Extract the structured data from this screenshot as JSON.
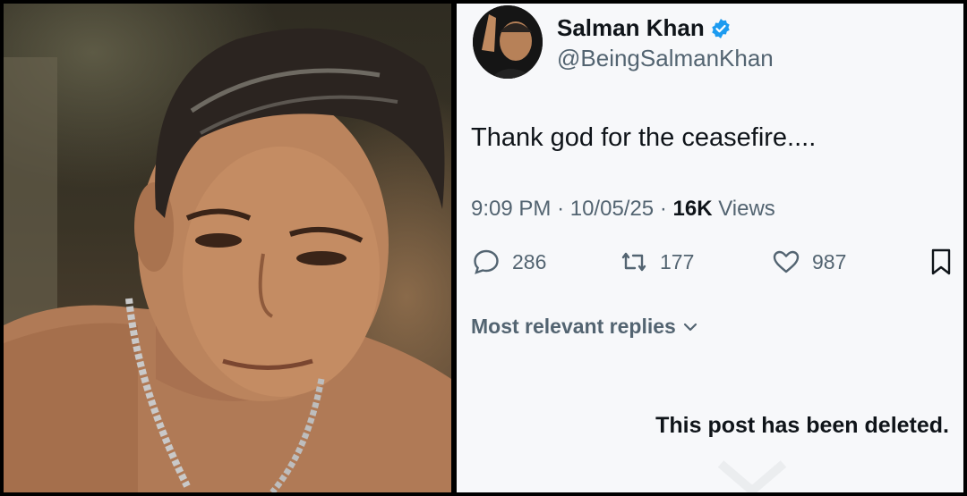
{
  "tweet": {
    "display_name": "Salman Khan",
    "handle": "@BeingSalmanKhan",
    "text": "Thank god for the ceasefire....",
    "time": "9:09 PM",
    "date": "10/05/25",
    "views_count": "16K",
    "views_label": "Views",
    "replies": "286",
    "retweets": "177",
    "likes": "987"
  },
  "replies_section": {
    "sort_label": "Most relevant replies"
  },
  "notice": {
    "deleted_text": "This post has been deleted."
  },
  "colors": {
    "text_primary": "#0f1419",
    "text_secondary": "#536471",
    "verified_blue": "#1d9bf0",
    "panel_bg": "#f7f8fa"
  },
  "icons": [
    "verified-icon",
    "reply-icon",
    "retweet-icon",
    "like-icon",
    "bookmark-icon",
    "chevron-down-icon"
  ]
}
